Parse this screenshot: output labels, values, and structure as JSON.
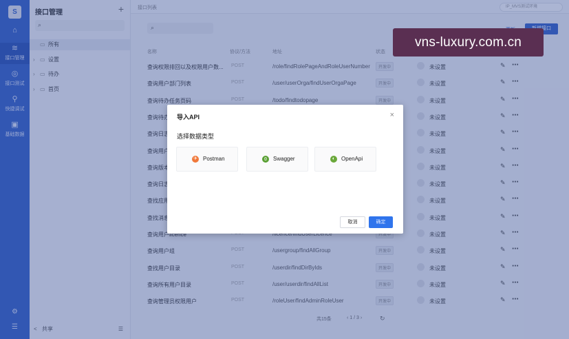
{
  "rail": {
    "logo": "S",
    "items": [
      {
        "icon": "⌂",
        "label": ""
      },
      {
        "icon": "≋",
        "label": "接口管理"
      },
      {
        "icon": "◎",
        "label": "接口测试"
      },
      {
        "icon": "⚲",
        "label": "快捷调试"
      },
      {
        "icon": "▣",
        "label": "基础数据"
      }
    ],
    "bottom_icons": [
      "⚙",
      "☰"
    ]
  },
  "tree": {
    "title": "接口管理",
    "plus": "+",
    "search_icon": "⌕",
    "items": [
      {
        "label": "所有",
        "caret": "",
        "selected": true
      },
      {
        "label": "设置",
        "caret": "›"
      },
      {
        "label": "待办",
        "caret": "›"
      },
      {
        "label": "首页",
        "caret": "›"
      }
    ],
    "footer_label": "共享",
    "footer_icon": "<",
    "footer_menu": "☰"
  },
  "main": {
    "tab": "接口列表",
    "env": "IP_MVS测试环境",
    "search_icon": "⌕",
    "link_button": "更新",
    "new_button": "新增接口",
    "headers": {
      "name": "名称",
      "method": "协议/方法",
      "path": "地址",
      "state": "状态"
    },
    "rows": [
      {
        "name": "查询权限排回以及权限用户数...",
        "method": "POST",
        "path": "/role/findRolePageAndRoleUserNumber",
        "state": "开发中",
        "assignee": "未设置"
      },
      {
        "name": "查询用户部门列表",
        "method": "POST",
        "path": "/user/userOrga/findUserOrgaPage",
        "state": "开发中",
        "assignee": "未设置"
      },
      {
        "name": "查询待办任务页码",
        "method": "POST",
        "path": "/todo/findtodopage",
        "state": "开发中",
        "assignee": "未设置"
      },
      {
        "name": "查询待办",
        "method": "POST",
        "path": "",
        "state": "",
        "assignee": "未设置"
      },
      {
        "name": "查询日志",
        "method": "POST",
        "path": "",
        "state": "",
        "assignee": "未设置"
      },
      {
        "name": "查询用户",
        "method": "POST",
        "path": "",
        "state": "",
        "assignee": "未设置"
      },
      {
        "name": "查询版本",
        "method": "POST",
        "path": "",
        "state": "",
        "assignee": "未设置"
      },
      {
        "name": "查询日志",
        "method": "POST",
        "path": "",
        "state": "",
        "assignee": "未设置"
      },
      {
        "name": "查找应用",
        "method": "POST",
        "path": "",
        "state": "",
        "assignee": "未设置"
      },
      {
        "name": "查找消息",
        "method": "POST",
        "path": "",
        "state": "",
        "assignee": "未设置"
      },
      {
        "name": "查询用户licence",
        "method": "POST",
        "path": "/licence/findUserLicence",
        "state": "开发中",
        "assignee": "未设置"
      },
      {
        "name": "查询用户组",
        "method": "POST",
        "path": "/usergroup/findAllGroup",
        "state": "开发中",
        "assignee": "未设置"
      },
      {
        "name": "查找用户目录",
        "method": "POST",
        "path": "/userdir/findDirByIds",
        "state": "开发中",
        "assignee": "未设置"
      },
      {
        "name": "查询所有用户目录",
        "method": "POST",
        "path": "/user/userdir/findAllList",
        "state": "开发中",
        "assignee": "未设置"
      },
      {
        "name": "查询管理员权限用户",
        "method": "POST",
        "path": "/roleUser/findAdminRoleUser",
        "state": "开发中",
        "assignee": "未设置"
      }
    ],
    "pager": {
      "total": "共15条",
      "pages": "‹ 1 / 3 ›",
      "refresh": "↻"
    },
    "edit_icon": "✎",
    "more_icon": "⋯"
  },
  "modal": {
    "title": "导入API",
    "close": "×",
    "subtitle": "选择数据类型",
    "options": [
      {
        "label": "Postman",
        "color": "#f0783a",
        "glyph": "✈"
      },
      {
        "label": "Swagger",
        "color": "#5aa034",
        "glyph": "{}"
      },
      {
        "label": "OpenApi",
        "color": "#6aa83a",
        "glyph": "◐"
      }
    ],
    "cancel": "取消",
    "ok": "确定"
  },
  "watermark": "vns-luxury.com.cn"
}
